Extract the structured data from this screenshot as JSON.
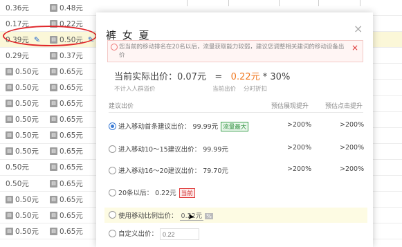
{
  "rows": [
    {
      "a": "0.36元",
      "b": "0.48元",
      "a_icon": false
    },
    {
      "a": "0.17元",
      "b": "0.22元",
      "a_icon": false
    },
    {
      "a": "0.39元",
      "b": "0.50元",
      "a_icon": false
    },
    {
      "a": "0.29元",
      "b": "0.37元",
      "a_icon": false
    },
    {
      "a": "0.50元",
      "b": "0.65元",
      "a_icon": true
    },
    {
      "a": "0.50元",
      "b": "0.65元",
      "a_icon": true
    },
    {
      "a": "0.50元",
      "b": "0.65元",
      "a_icon": true
    },
    {
      "a": "0.50元",
      "b": "0.65元",
      "a_icon": true
    },
    {
      "a": "0.50元",
      "b": "0.65元",
      "a_icon": true
    },
    {
      "a": "0.50元",
      "b": "0.65元",
      "a_icon": true
    },
    {
      "a": "0.50元",
      "b": "0.65元",
      "a_icon": false
    },
    {
      "a": "0.50元",
      "b": "0.65元",
      "a_icon": false
    },
    {
      "a": "0.50元",
      "b": "0.65元",
      "a_icon": true
    },
    {
      "a": "0.50元",
      "b": "0.65元",
      "a_icon": true
    },
    {
      "a": "0.50元",
      "b": "0.65元",
      "a_icon": true
    }
  ],
  "modal": {
    "title": "裤 女 夏",
    "close": "×",
    "notice": "您当前的移动排名在20名以后，流量获取能力较弱，建议您调整相关建词的移动设备出价",
    "notice_close": "×",
    "price_label": "当前实际出价：0.07元",
    "price_eq": "=",
    "price_value": "0.22元",
    "price_mult": "* 30%",
    "sub_left": "不计入人群溢价",
    "sub_mid": "当前出价",
    "sub_right": "分时折扣",
    "header_col1": "建议出价",
    "header_col2": "预估展现提升",
    "header_col3": "预估点击提升",
    "options": [
      {
        "label": "进入移动首条建议出价：  99.99元",
        "badge": "流量最大",
        "p1": ">200%",
        "p2": ">200%"
      },
      {
        "label": "进入移动10～15建议出价：  99.99元",
        "badge": "",
        "p1": ">200%",
        "p2": ">200%"
      },
      {
        "label": "进入移动16～20建议出价：  79.70元",
        "badge": "",
        "p1": ">200%",
        "p2": ">200%"
      },
      {
        "label": "20条以后：  0.22元",
        "badge": "当前",
        "p1": "",
        "p2": ""
      }
    ],
    "ratio_label": "使用移动比例出价：",
    "ratio_value": "0.22元",
    "ratio_pct": "%",
    "custom_label": "自定义出价：",
    "custom_placeholder": "0.22"
  }
}
